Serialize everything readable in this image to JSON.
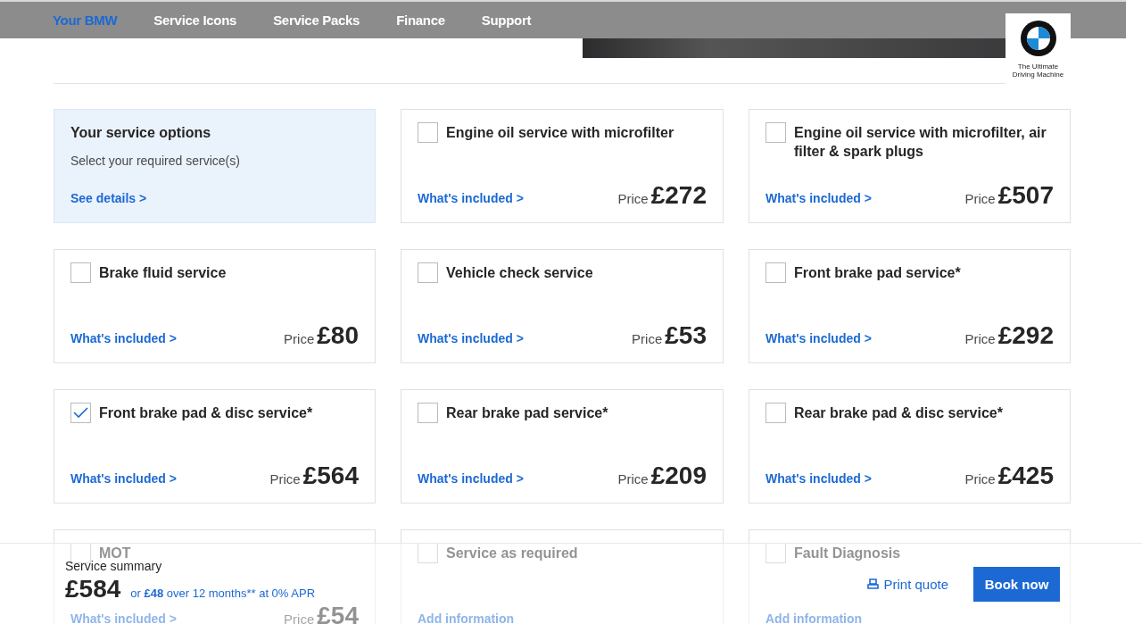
{
  "nav": {
    "items": [
      {
        "label": "Your BMW",
        "selected": true
      },
      {
        "label": "Service Icons",
        "selected": false
      },
      {
        "label": "Service Packs",
        "selected": false
      },
      {
        "label": "Finance",
        "selected": false
      },
      {
        "label": "Support",
        "selected": false
      }
    ]
  },
  "logo": {
    "tagline": "The Ultimate Driving Machine"
  },
  "intro": {
    "title": "Your service options",
    "subtitle": "Select your required service(s)",
    "link": "See details >"
  },
  "services": [
    {
      "title": "Engine oil service with microfilter",
      "checked": false,
      "link": "What's included >",
      "price_label": "Price",
      "price": "£272"
    },
    {
      "title": "Engine oil service with microfilter, air filter & spark plugs",
      "checked": false,
      "link": "What's included >",
      "price_label": "Price",
      "price": "£507"
    },
    {
      "title": "Brake fluid service",
      "checked": false,
      "link": "What's included >",
      "price_label": "Price",
      "price": "£80"
    },
    {
      "title": "Vehicle check service",
      "checked": false,
      "link": "What's included >",
      "price_label": "Price",
      "price": "£53"
    },
    {
      "title": "Front brake pad service*",
      "checked": false,
      "link": "What's included >",
      "price_label": "Price",
      "price": "£292"
    },
    {
      "title": "Front brake pad & disc service*",
      "checked": true,
      "link": "What's included >",
      "price_label": "Price",
      "price": "£564"
    },
    {
      "title": "Rear brake pad service*",
      "checked": false,
      "link": "What's included >",
      "price_label": "Price",
      "price": "£209"
    },
    {
      "title": "Rear brake pad & disc service*",
      "checked": false,
      "link": "What's included >",
      "price_label": "Price",
      "price": "£425"
    },
    {
      "title": "MOT",
      "checked": false,
      "link": "What's included >",
      "price_label": "Price",
      "price": "£54"
    },
    {
      "title": "Service as required",
      "checked": false,
      "link": "Add information"
    },
    {
      "title": "Fault Diagnosis",
      "checked": false,
      "link": "Add information"
    }
  ],
  "summary": {
    "title": "Service summary",
    "total": "£584",
    "finance_prefix": "or",
    "finance_amount": "£48",
    "finance_suffix": "over 12 months** at 0% APR",
    "print": "Print quote",
    "book": "Book now"
  }
}
